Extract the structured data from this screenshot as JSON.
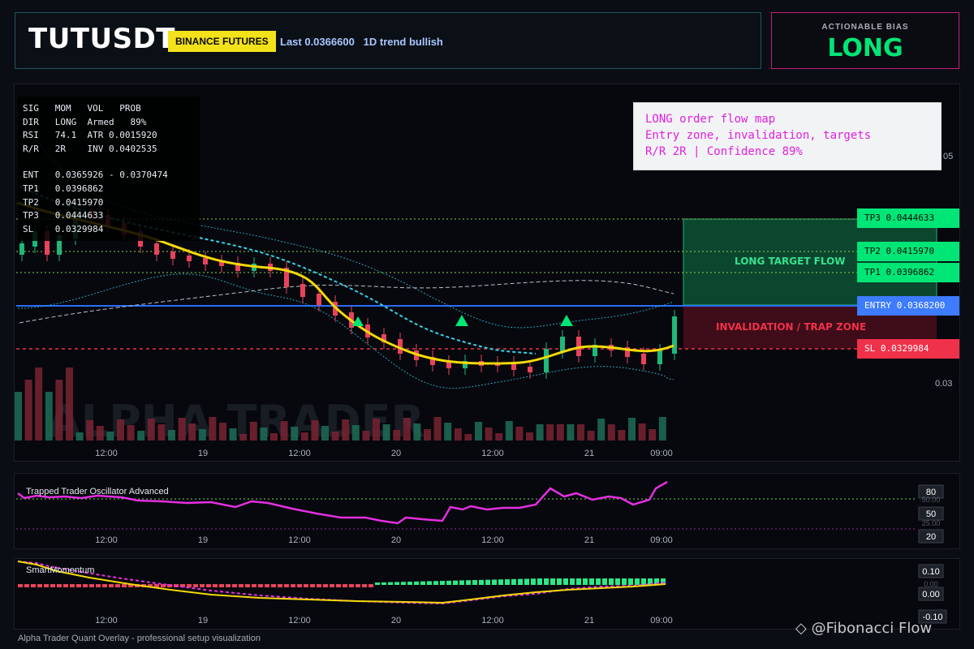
{
  "header": {
    "symbol": "TUTUSDT",
    "exchange": "BINANCE FUTURES",
    "last_info": "Last 0.0366600   1D trend bullish"
  },
  "bias": {
    "label": "ACTIONABLE BIAS",
    "value": "LONG"
  },
  "stats": {
    "row1": "SIG   MOM   VOL   PROB",
    "row2": "DIR   LONG  Armed   89%",
    "row3": "RSI   74.1  ATR 0.0015920",
    "row4": "R/R   2R    INV 0.0402535",
    "row5": "ENT   0.0365926 - 0.0370474",
    "row6": "TP1   0.0396862",
    "row7": "TP2   0.0415970",
    "row8": "TP3   0.0444633",
    "row9": "SL    0.0329984"
  },
  "note": {
    "line1": "LONG order flow map",
    "line2": "Entry zone, invalidation, targets",
    "line3": "R/R 2R | Confidence 89%"
  },
  "levels": {
    "tp3": "TP3 0.0444633",
    "tp2": "TP2 0.0415970",
    "tp1": "TP1 0.0396862",
    "entry": "ENTRY 0.0368200",
    "sl": "SL 0.0329984"
  },
  "zones": {
    "target": "LONG TARGET FLOW",
    "trap": "INVALIDATION / TRAP ZONE"
  },
  "price_axis": {
    "tick_upper": "05",
    "tick_lower": "0.03"
  },
  "time_axis": [
    "12:00",
    "19",
    "12:00",
    "20",
    "12:00",
    "21",
    "09:00"
  ],
  "oscillator": {
    "title": "Trapped Trader Oscillator Advanced",
    "levels": [
      "80",
      "50",
      "20"
    ],
    "partial_upper": "50.00",
    "partial_lower": "25.00"
  },
  "momentum": {
    "title": "SmartMomentum",
    "levels": [
      "0.10",
      "0.00",
      "-0.10"
    ],
    "partial": "0.00"
  },
  "watermark": "ALPHA TRADER",
  "footer": "Alpha Trader Quant Overlay - professional setup visualization",
  "credit": "@Fibonacci Flow",
  "colors": {
    "bull": "#1fb87a",
    "bear": "#e8435a",
    "entry": "#2d6cff",
    "tp": "#00e676",
    "sl": "#f0314a",
    "ema": "#f5d90a",
    "oscillator": "#e52fe0"
  },
  "chart_data": {
    "type": "candlestick",
    "y_ticks_visible": [
      "05",
      "0.03"
    ],
    "entry": 0.03682,
    "sl": 0.0329984,
    "tp1": 0.0396862,
    "tp2": 0.041597,
    "tp3": 0.0444633,
    "x_ticks": [
      "12:00",
      "19",
      "12:00",
      "20",
      "12:00",
      "21",
      "09:00"
    ]
  }
}
